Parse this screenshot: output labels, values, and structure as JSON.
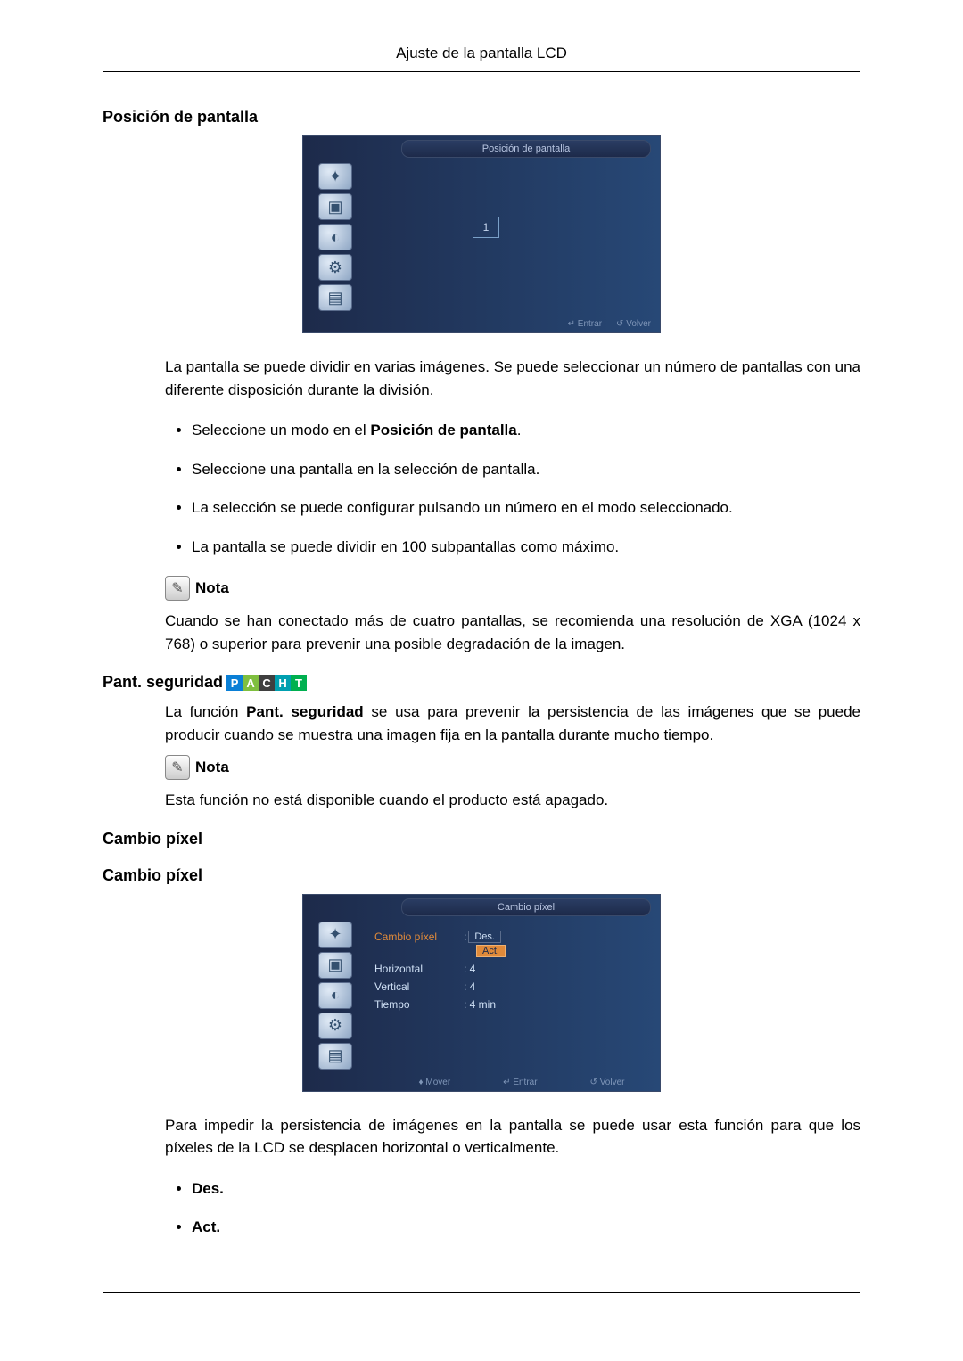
{
  "header": "Ajuste de la pantalla LCD",
  "section1": {
    "title": "Posición de pantalla",
    "osd_title": "Posición de pantalla",
    "osd_value": "1",
    "footer_entrar": "Entrar",
    "footer_volver": "Volver",
    "intro": "La pantalla se puede dividir en varias imágenes. Se puede seleccionar un número de pantallas con una diferente disposición durante la división.",
    "bullets": [
      {
        "prefix": "Seleccione un modo en el ",
        "bold": "Posición de pantalla",
        "suffix": "."
      },
      {
        "prefix": "Seleccione una pantalla en la selección de pantalla.",
        "bold": "",
        "suffix": ""
      },
      {
        "prefix": "La selección se puede configurar pulsando un número en el modo seleccionado.",
        "bold": "",
        "suffix": ""
      },
      {
        "prefix": "La pantalla se puede dividir en 100 subpantallas como máximo.",
        "bold": "",
        "suffix": ""
      }
    ],
    "note_label": "Nota",
    "note_text": "Cuando se han conectado más de cuatro pantallas, se recomienda una resolución de XGA (1024 x 768) o superior para prevenir una posible degradación de la imagen."
  },
  "section2": {
    "title": "Pant. seguridad",
    "badges": [
      "P",
      "A",
      "C",
      "H",
      "T"
    ],
    "badge_colors": [
      "#0a7fd6",
      "#7fbf3f",
      "#3f3f3f",
      "#00a0b0",
      "#00b050"
    ],
    "intro_a": "La función ",
    "intro_bold": "Pant. seguridad",
    "intro_b": " se usa para prevenir la persistencia de las imágenes que se puede producir cuando se muestra una imagen fija en la pantalla durante mucho tiempo.",
    "note_label": "Nota",
    "note_text": "Esta función no está disponible cuando el producto está apagado."
  },
  "section3": {
    "title1": "Cambio píxel",
    "title2": "Cambio píxel",
    "osd_title": "Cambio píxel",
    "rows": [
      {
        "label": "Cambio píxel",
        "val_des": "Des.",
        "val_sel": "Act."
      },
      {
        "label": "Horizontal",
        "val": ": 4"
      },
      {
        "label": "Vertical",
        "val": ": 4"
      },
      {
        "label": "Tiempo",
        "val": ": 4 min"
      }
    ],
    "footer_mover": "Mover",
    "footer_entrar": "Entrar",
    "footer_volver": "Volver",
    "intro": "Para impedir la persistencia de imágenes en la pantalla se puede usar esta función para que los píxeles de la LCD se desplacen horizontal o verticalmente.",
    "bullets": [
      "Des.",
      "Act."
    ]
  }
}
